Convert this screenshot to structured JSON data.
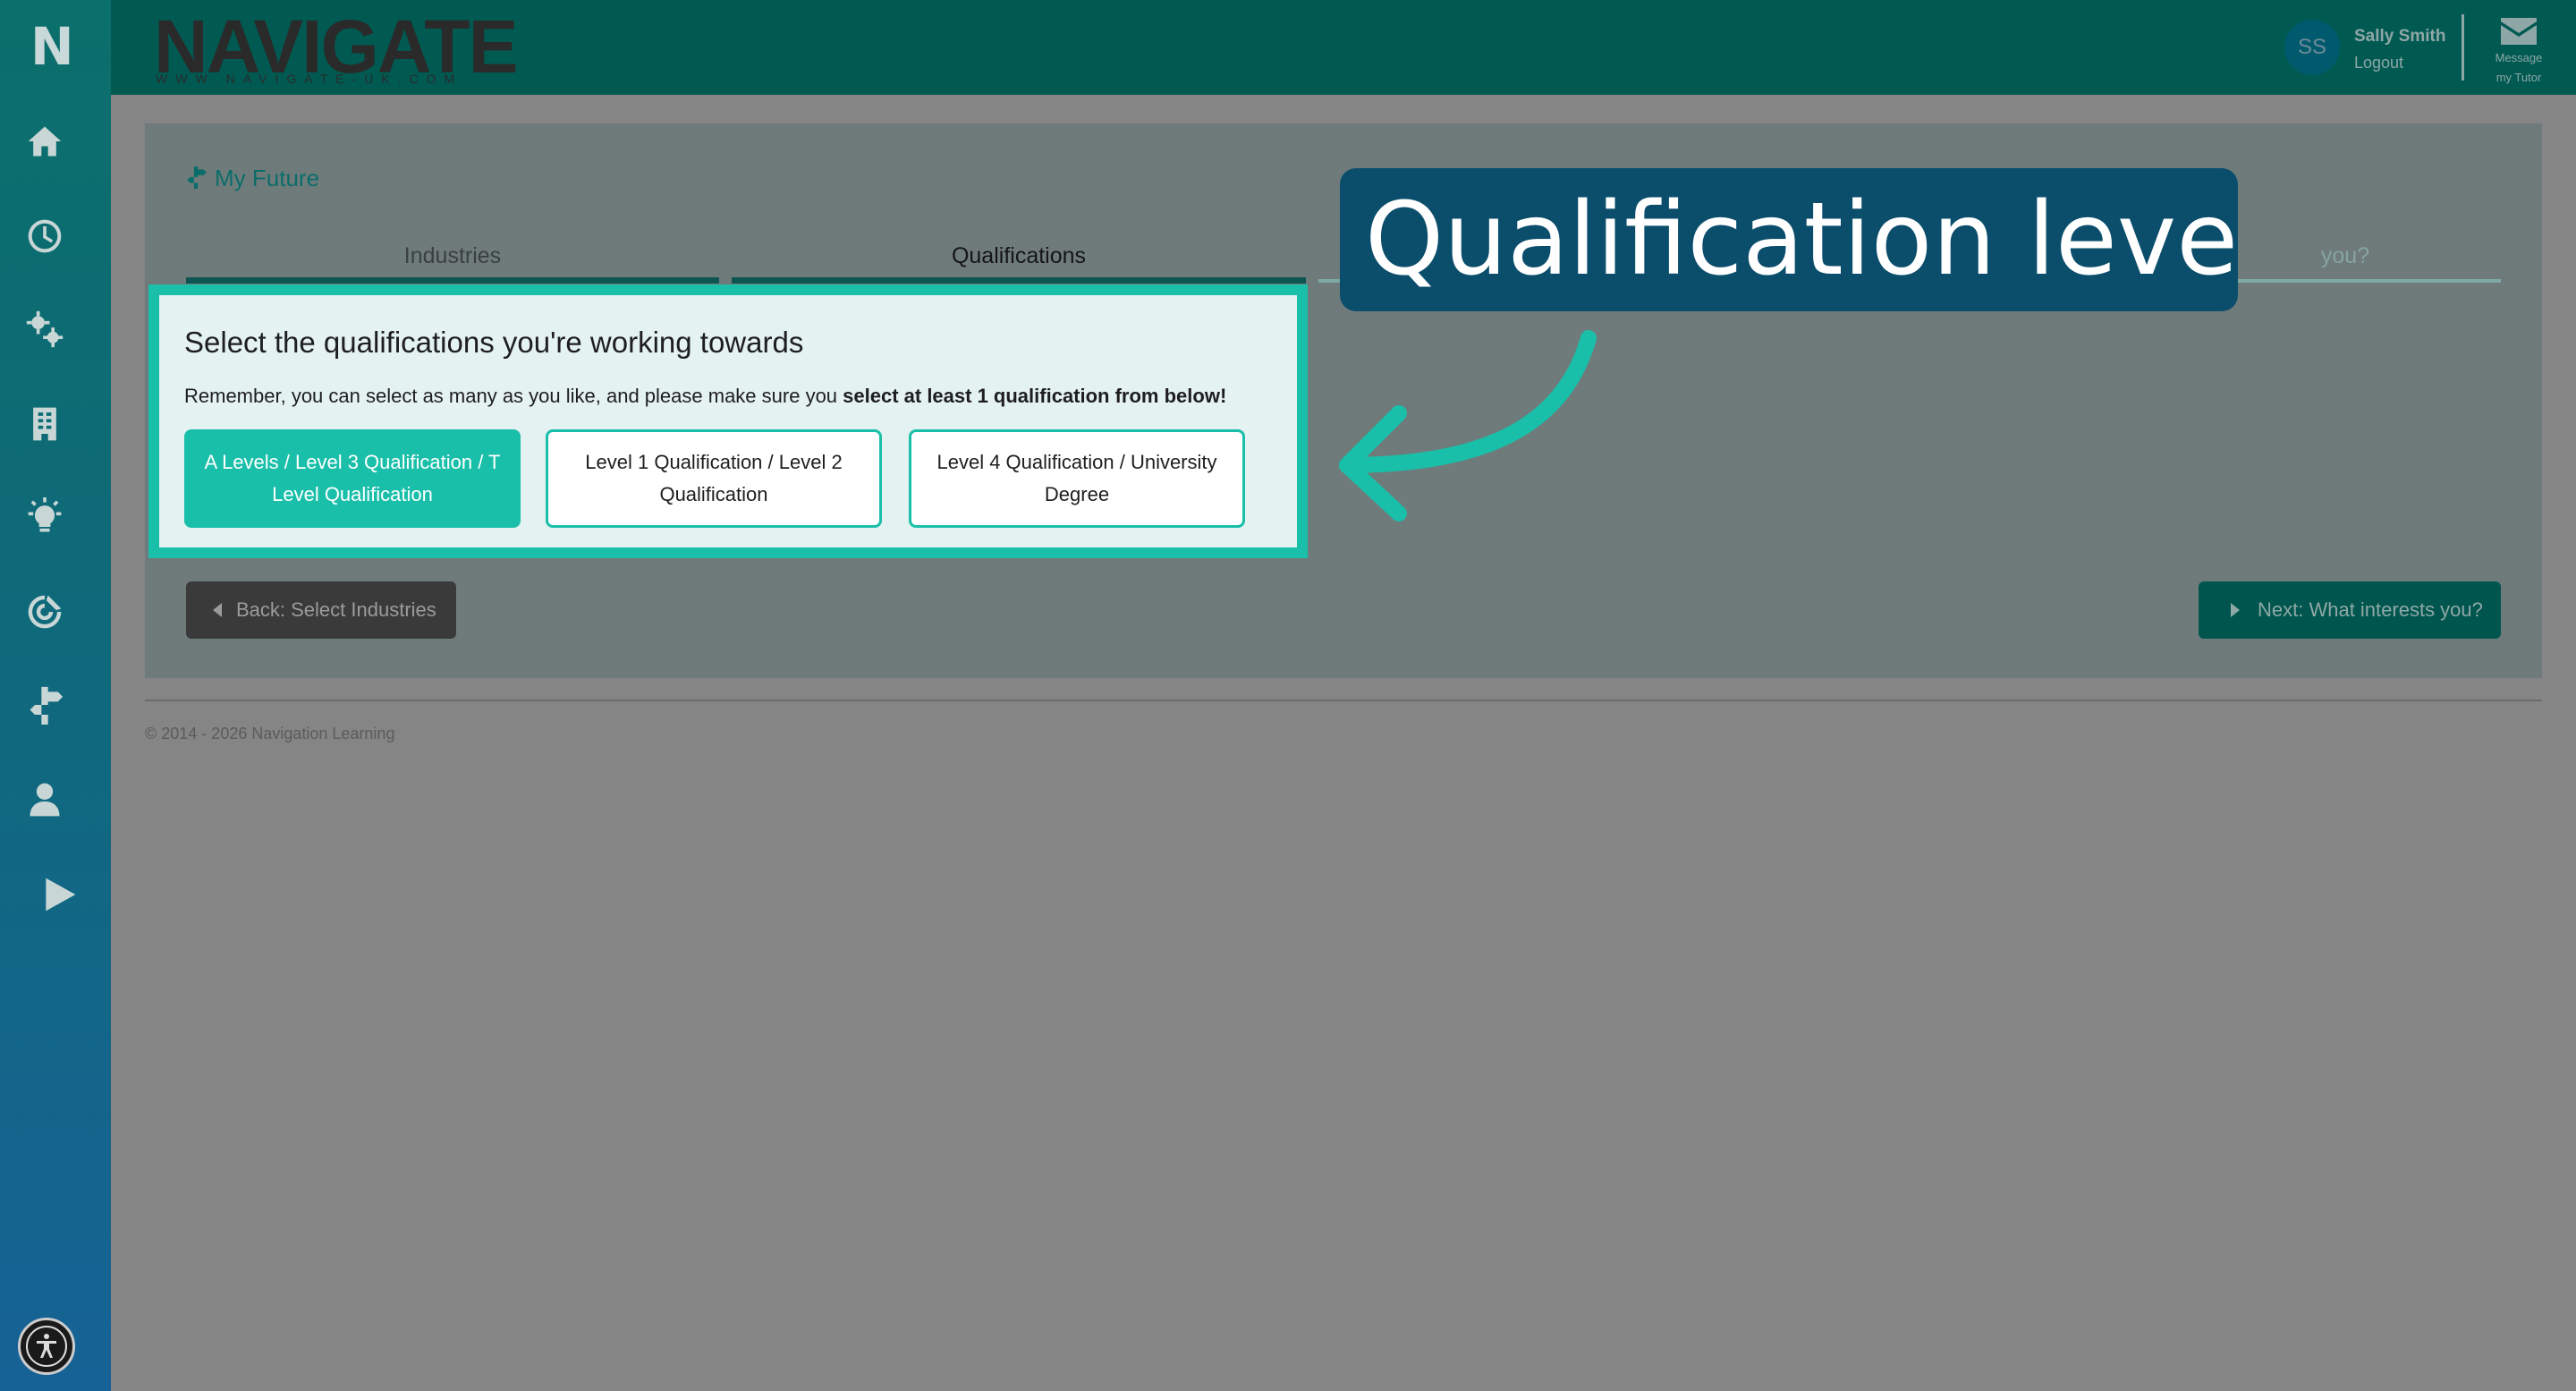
{
  "app": {
    "logo_letter": "N",
    "brand_name": "NAVIGATE",
    "brand_url": "WWW.NAVIGATE-UK.COM"
  },
  "user": {
    "initials": "SS",
    "name": "Sally Smith",
    "logout": "Logout",
    "message_label_1": "Message",
    "message_label_2": "my Tutor"
  },
  "sidebar": {
    "items": [
      {
        "name": "home-icon"
      },
      {
        "name": "clock-icon"
      },
      {
        "name": "gears-icon"
      },
      {
        "name": "building-icon"
      },
      {
        "name": "lightbulb-icon"
      },
      {
        "name": "target-icon"
      },
      {
        "name": "signpost-icon"
      },
      {
        "name": "user-icon"
      },
      {
        "name": "play-icon"
      }
    ],
    "accessibility": "accessibility-icon"
  },
  "page": {
    "section_title": "My Future",
    "tabs": [
      {
        "label": "Industries"
      },
      {
        "label": "Qualifications"
      },
      {
        "label": "you?"
      }
    ],
    "back_label": "Back: Select Industries",
    "next_label": "Next: What interests you?"
  },
  "qualifications": {
    "heading": "Select the qualifications you're working towards",
    "note_prefix": "Remember, you can select as many as you like, and please make sure you ",
    "note_bold": "select at least 1 qualification from below!",
    "options": [
      {
        "label": "A Levels / Level 3 Qualification / T Level Qualification",
        "selected": true
      },
      {
        "label": "Level 1 Qualification / Level 2 Qualification",
        "selected": false
      },
      {
        "label": "Level 4 Qualification / University Degree",
        "selected": false
      }
    ]
  },
  "callout": {
    "text": "Qualification level"
  },
  "footer": {
    "copyright": "© 2014 - 2026 Navigation Learning"
  },
  "colors": {
    "accent": "#19bfa9",
    "topbar": "#005a52",
    "callout": "#0b4e6c"
  }
}
